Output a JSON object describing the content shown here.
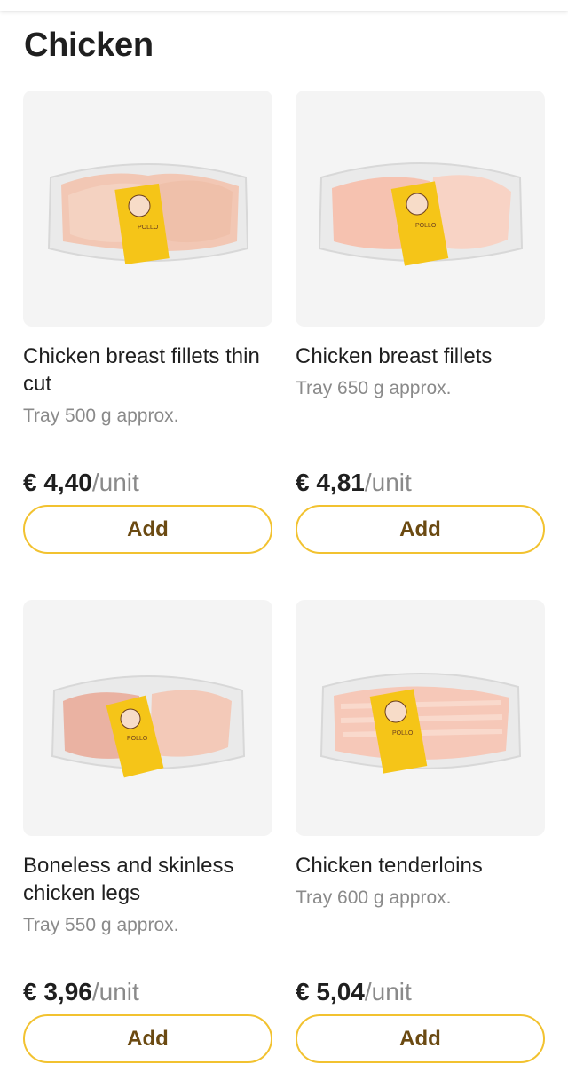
{
  "section": {
    "title": "Chicken"
  },
  "colors": {
    "accent_border": "#f2c230",
    "button_text": "#6b4a12",
    "label_yellow": "#f5c518"
  },
  "products": [
    {
      "name": "Chicken breast fillets thin cut",
      "desc": "Tray 500 g approx.",
      "price": "€ 4,40",
      "unit": "/unit",
      "button": "Add",
      "image_icon": "chicken-breast-thin-tray-image",
      "label_text": "POLLO"
    },
    {
      "name": "Chicken breast fillets",
      "desc": "Tray 650 g approx.",
      "price": "€ 4,81",
      "unit": "/unit",
      "button": "Add",
      "image_icon": "chicken-breast-tray-image",
      "label_text": "POLLO"
    },
    {
      "name": "Boneless and skinless chicken legs",
      "desc": "Tray 550 g approx.",
      "price": "€ 3,96",
      "unit": "/unit",
      "button": "Add",
      "image_icon": "chicken-legs-tray-image",
      "label_text": "POLLO"
    },
    {
      "name": "Chicken tenderloins",
      "desc": "Tray 600 g approx.",
      "price": "€ 5,04",
      "unit": "/unit",
      "button": "Add",
      "image_icon": "chicken-tenderloins-tray-image",
      "label_text": "POLLO"
    }
  ]
}
